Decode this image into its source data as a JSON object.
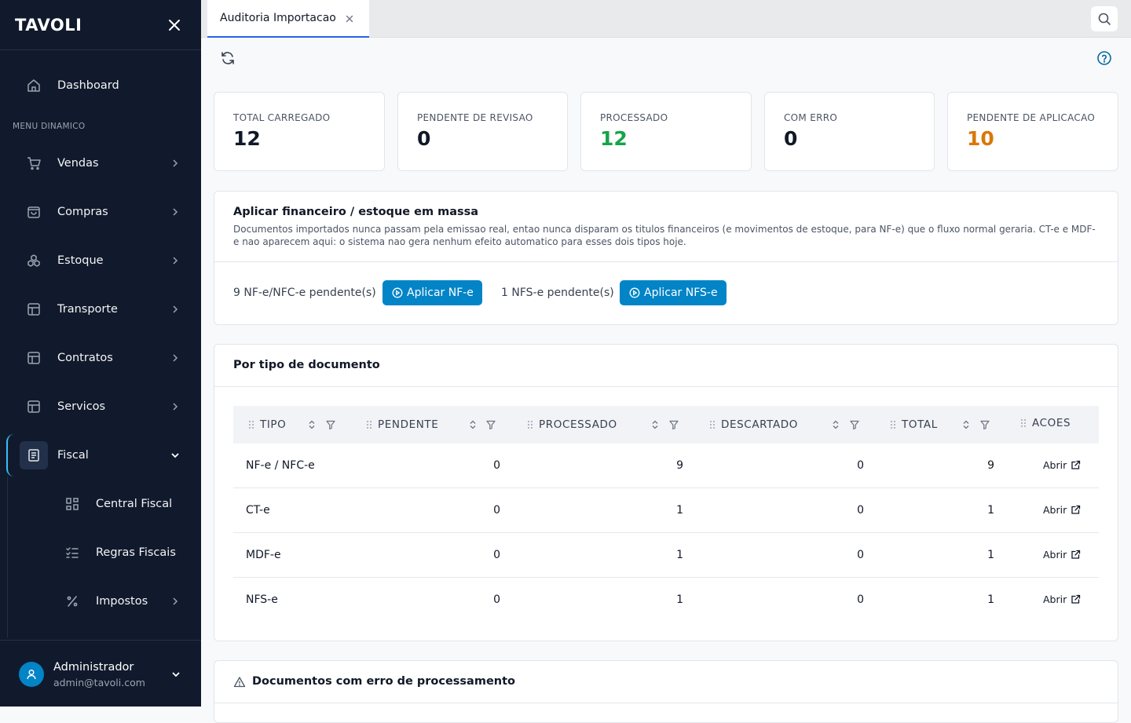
{
  "sidebar": {
    "logo": "TAVOLI",
    "dashboard": "Dashboard",
    "section": "MENU DINAMICO",
    "items": [
      {
        "label": "Vendas"
      },
      {
        "label": "Compras"
      },
      {
        "label": "Estoque"
      },
      {
        "label": "Transporte"
      },
      {
        "label": "Contratos"
      },
      {
        "label": "Servicos"
      },
      {
        "label": "Fiscal"
      }
    ],
    "subitems": [
      {
        "label": "Central Fiscal"
      },
      {
        "label": "Regras Fiscais"
      },
      {
        "label": "Impostos"
      }
    ],
    "user": {
      "name": "Administrador",
      "email": "admin@tavoli.com"
    }
  },
  "tabs": [
    {
      "label": "Auditoria Importacao"
    }
  ],
  "stats": [
    {
      "label": "TOTAL CARREGADO",
      "value": "12",
      "color": "#111827"
    },
    {
      "label": "PENDENTE DE REVISAO",
      "value": "0",
      "color": "#111827"
    },
    {
      "label": "PROCESSADO",
      "value": "12",
      "color": "#16a34a"
    },
    {
      "label": "COM ERRO",
      "value": "0",
      "color": "#111827"
    },
    {
      "label": "PENDENTE DE APLICACAO",
      "value": "10",
      "color": "#d97706"
    }
  ],
  "bulk": {
    "title": "Aplicar financeiro / estoque em massa",
    "desc": "Documentos importados nunca passam pela emissao real, entao nunca disparam os titulos financeiros (e movimentos de estoque, para NF-e) que o fluxo normal geraria. CT-e e MDF-e nao aparecem aqui: o sistema nao gera nenhum efeito automatico para esses dois tipos hoje.",
    "nfe_pending": "9 NF-e/NFC-e pendente(s)",
    "nfe_button": "Aplicar NF-e",
    "nfse_pending": "1 NFS-e pendente(s)",
    "nfse_button": "Aplicar NFS-e"
  },
  "bytype": {
    "title": "Por tipo de documento",
    "columns": [
      "TIPO",
      "PENDENTE",
      "PROCESSADO",
      "DESCARTADO",
      "TOTAL",
      "ACOES"
    ],
    "rows": [
      {
        "tipo": "NF-e / NFC-e",
        "pendente": "0",
        "processado": "9",
        "descartado": "0",
        "total": "9",
        "acao": "Abrir"
      },
      {
        "tipo": "CT-e",
        "pendente": "0",
        "processado": "1",
        "descartado": "0",
        "total": "1",
        "acao": "Abrir"
      },
      {
        "tipo": "MDF-e",
        "pendente": "0",
        "processado": "1",
        "descartado": "0",
        "total": "1",
        "acao": "Abrir"
      },
      {
        "tipo": "NFS-e",
        "pendente": "0",
        "processado": "1",
        "descartado": "0",
        "total": "1",
        "acao": "Abrir"
      }
    ]
  },
  "errors": {
    "title": "Documentos com erro de processamento"
  }
}
